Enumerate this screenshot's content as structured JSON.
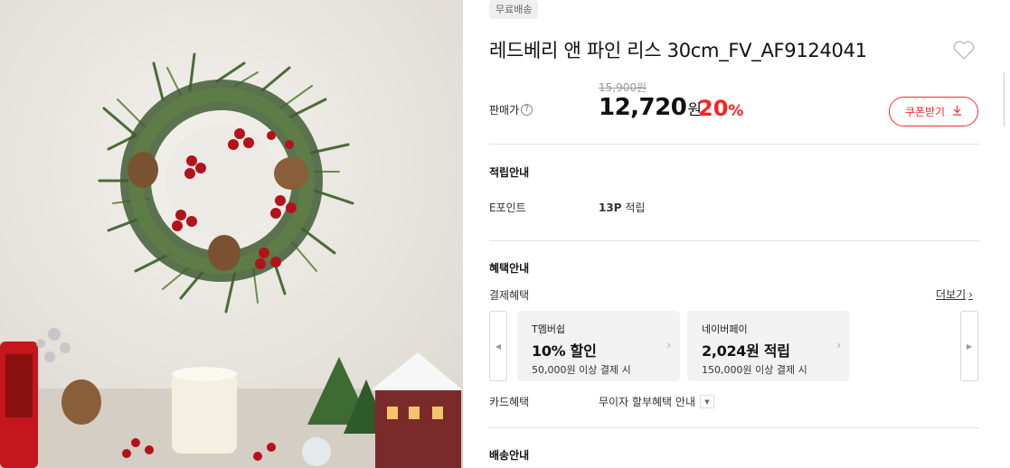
{
  "shipping_badge": "무료배송",
  "product_title": "레드베리 앤 파인 리스 30cm_FV_AF9124041",
  "price": {
    "label": "판매가",
    "help_icon_glyph": "?",
    "original": "15,900원",
    "sale": "12,720",
    "sale_unit": "원",
    "discount": "20",
    "discount_unit": "%"
  },
  "coupon_button": "쿠폰받기",
  "points": {
    "section_title": "적립안내",
    "label": "E포인트",
    "value_bold": "13P",
    "value_rest": " 적립"
  },
  "benefits": {
    "section_title": "혜택안내",
    "payment_label": "결제혜택",
    "more_link": "더보기",
    "cards": [
      {
        "name": "T멤버쉽",
        "main": "10% 할인",
        "sub": "50,000원 이상 결제 시"
      },
      {
        "name": "네이버페이",
        "main": "2,024원 적립",
        "sub": "150,000원 이상 결제 시"
      }
    ],
    "card_label": "카드혜택",
    "card_value": "무이자 할부혜택 안내"
  },
  "shipping": {
    "section_title": "배송안내"
  },
  "colors": {
    "accent_red": "#ff2020",
    "divider": "#e2e2e2",
    "card_bg": "#f2f2f2"
  },
  "icons": [
    "heart-icon",
    "help-icon",
    "download-icon",
    "chevron-right-icon",
    "chevron-left-icon",
    "caret-down-icon"
  ]
}
